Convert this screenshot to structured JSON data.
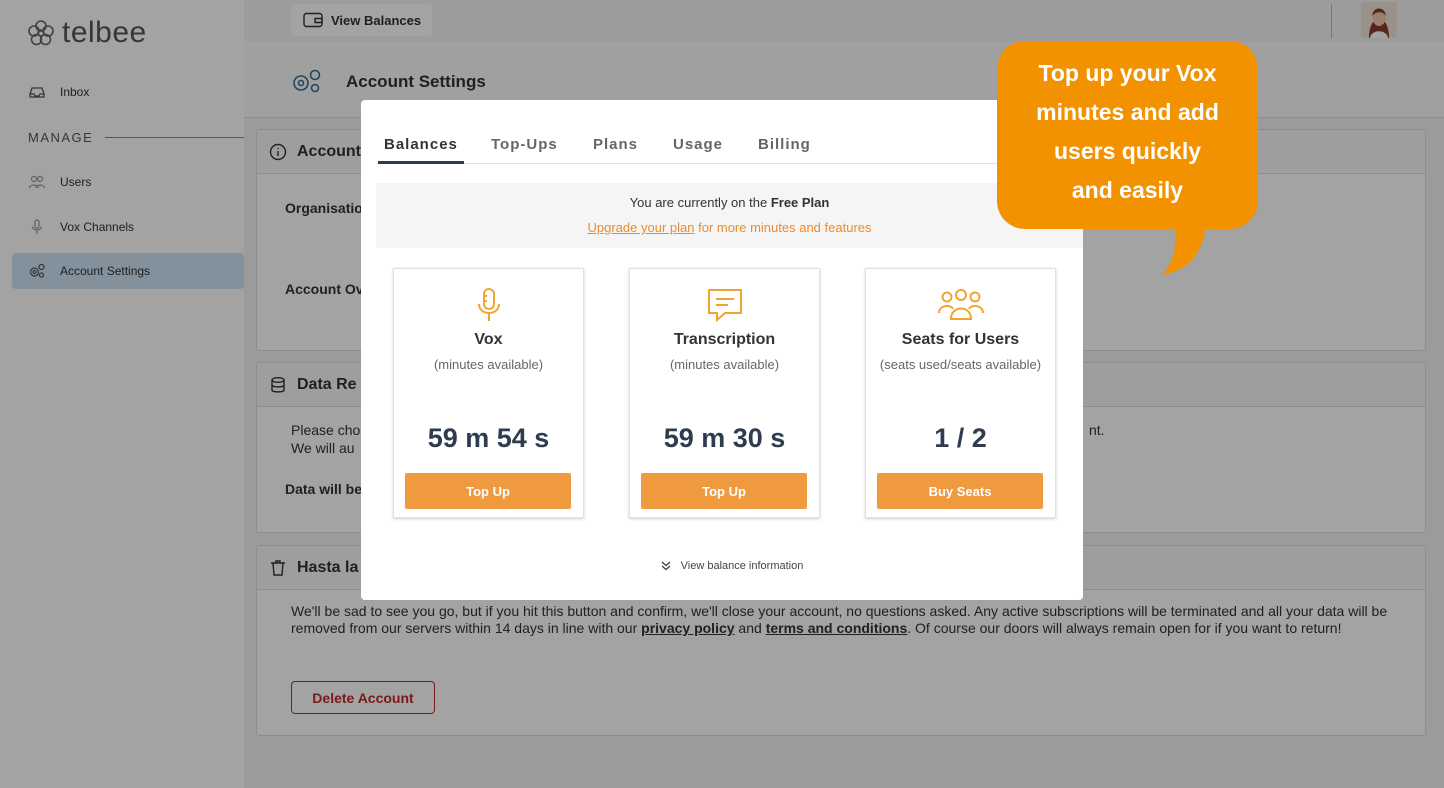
{
  "sidebar": {
    "brand": "telbee",
    "items": [
      {
        "label": "Inbox"
      },
      {
        "label": "Users"
      },
      {
        "label": "Vox Channels"
      },
      {
        "label": "Account Settings"
      }
    ],
    "section_label": "MANAGE"
  },
  "topbar": {
    "view_balances_label": "View Balances"
  },
  "page": {
    "title": "Account Settings",
    "sections": {
      "account": {
        "title": "Account",
        "organisation_label": "Organisatio",
        "owner_label": "Account Ov"
      },
      "data_retention": {
        "title": "Data Re",
        "line1": "Please cho",
        "line1_tail": "nt.",
        "line2": "We will au",
        "label": "Data will be"
      },
      "hasta": {
        "title": "Hasta la",
        "text_before_privacy": "We'll be sad to see you go, but if you hit this button and confirm, we'll close your account, no questions asked. Any active subscriptions will be terminated and all your data will be removed from our servers within 14 days in line with our ",
        "privacy": "privacy policy",
        "and": " and ",
        "terms": "terms and conditions",
        "text_after": ". Of course our doors will always remain open for if you want to return!",
        "delete_label": "Delete Account"
      }
    }
  },
  "modal": {
    "tabs": [
      {
        "label": "Balances"
      },
      {
        "label": "Top-Ups"
      },
      {
        "label": "Plans"
      },
      {
        "label": "Usage"
      },
      {
        "label": "Billing"
      }
    ],
    "plan": {
      "prefix": "You are currently on the ",
      "plan_name": "Free Plan",
      "upgrade_link": "Upgrade your plan",
      "upgrade_suffix": " for more minutes and features"
    },
    "cards": [
      {
        "icon": "microphone-icon",
        "name": "Vox",
        "sub": "(minutes available)",
        "value": "59 m 54 s",
        "button": "Top Up"
      },
      {
        "icon": "chat-icon",
        "name": "Transcription",
        "sub": "(minutes available)",
        "value": "59 m 30 s",
        "button": "Top Up"
      },
      {
        "icon": "users-icon",
        "name": "Seats for Users",
        "sub": "(seats used/seats available)",
        "value": "1 / 2",
        "button": "Buy Seats"
      }
    ],
    "view_info": "View balance information"
  },
  "callout": {
    "lines": [
      "Top up your Vox",
      "minutes and add",
      "users quickly",
      "and easily"
    ]
  },
  "colors": {
    "accent_orange": "#f09a40",
    "callout_orange": "#f39200",
    "navy": "#2f3b4f",
    "danger": "#c62828"
  }
}
